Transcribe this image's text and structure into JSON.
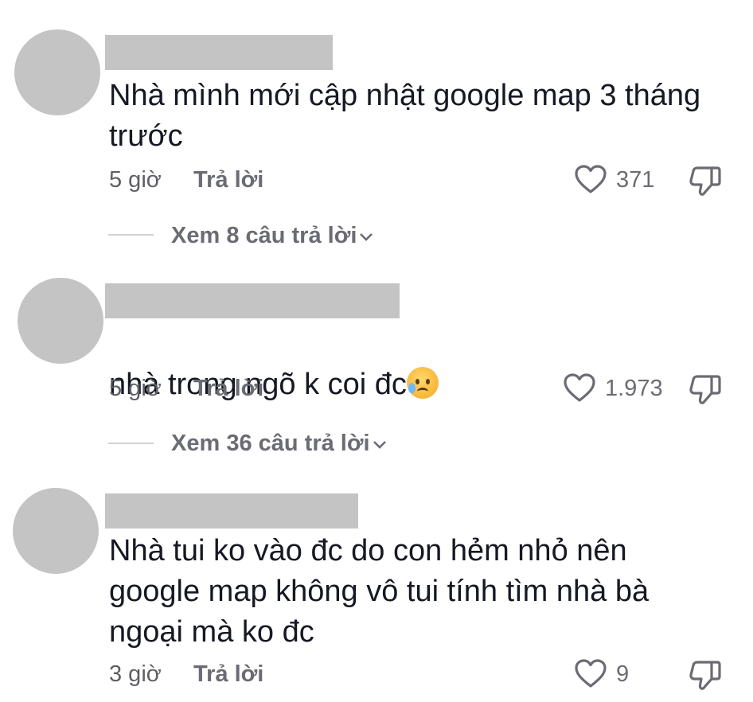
{
  "comments": [
    {
      "text": "Nhà mình mới cập nhật google map 3 tháng\ntrước",
      "time": "5 giờ",
      "reply_label": "Trả lời",
      "likes": "371",
      "view_replies": "Xem 8 câu trả lời",
      "emoji": ""
    },
    {
      "text": "nhà trong ngõ k coi đc",
      "time": "5 giờ",
      "reply_label": "Trả lời",
      "likes": "1.973",
      "view_replies": "Xem 36 câu trả lời",
      "emoji": "sad-but-relieved-face"
    },
    {
      "text": "Nhà tui ko vào đc do con hẻm nhỏ nên\ngoogle map không vô tui tính tìm nhà bà\nngoại mà ko đc",
      "time": "3 giờ",
      "reply_label": "Trả lời",
      "likes": "9",
      "emoji": ""
    }
  ],
  "icons": {
    "like": "heart-outline-icon",
    "dislike": "thumbs-down-outline-icon",
    "expand": "chevron-down-icon"
  },
  "colors": {
    "placeholder_gray": "#c4c4c4",
    "text": "#161823",
    "meta": "#6b6c73"
  }
}
